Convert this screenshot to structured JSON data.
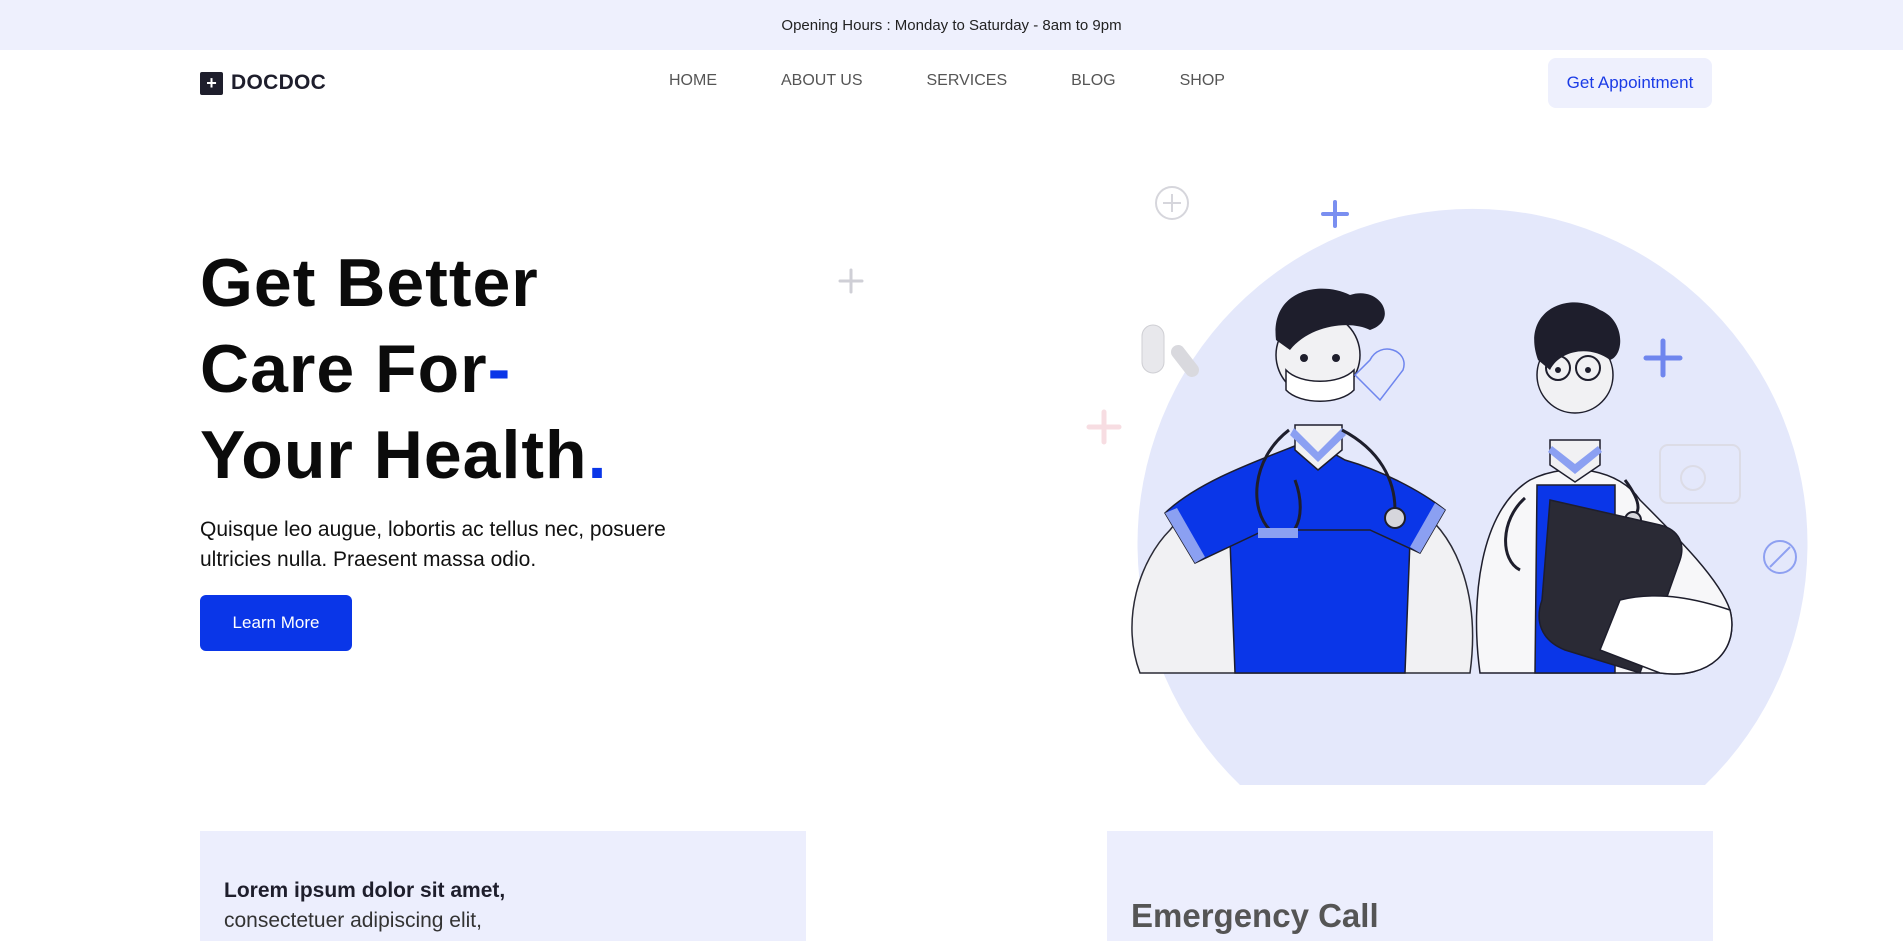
{
  "topbar": {
    "text": "Opening Hours : Monday to Saturday - 8am to 9pm"
  },
  "header": {
    "logo_text": "DOCDOC",
    "logo_icon": "plus-icon",
    "menu": [
      {
        "label": "HOME"
      },
      {
        "label": "ABOUT US"
      },
      {
        "label": "SERVICES"
      },
      {
        "label": "BLOG"
      },
      {
        "label": "SHOP"
      }
    ],
    "cta_label": "Get Appointment"
  },
  "hero": {
    "line1": "Get Better",
    "line2": "Care For",
    "line2_accent": "-",
    "line3": "Your Health",
    "line3_accent": ".",
    "subtitle": "Quisque leo augue, lobortis ac tellus nec, posuere ultricies nulla. Praesent massa odio.",
    "button_label": "Learn More"
  },
  "cards": {
    "left_bold": "Lorem ipsum dolor sit amet,",
    "left_text": "consectetuer adipiscing elit,",
    "right_title": "Emergency Call"
  },
  "colors": {
    "accent": "#0a36e8",
    "light_bg": "#eef0fd",
    "dark": "#1e1e2c"
  }
}
